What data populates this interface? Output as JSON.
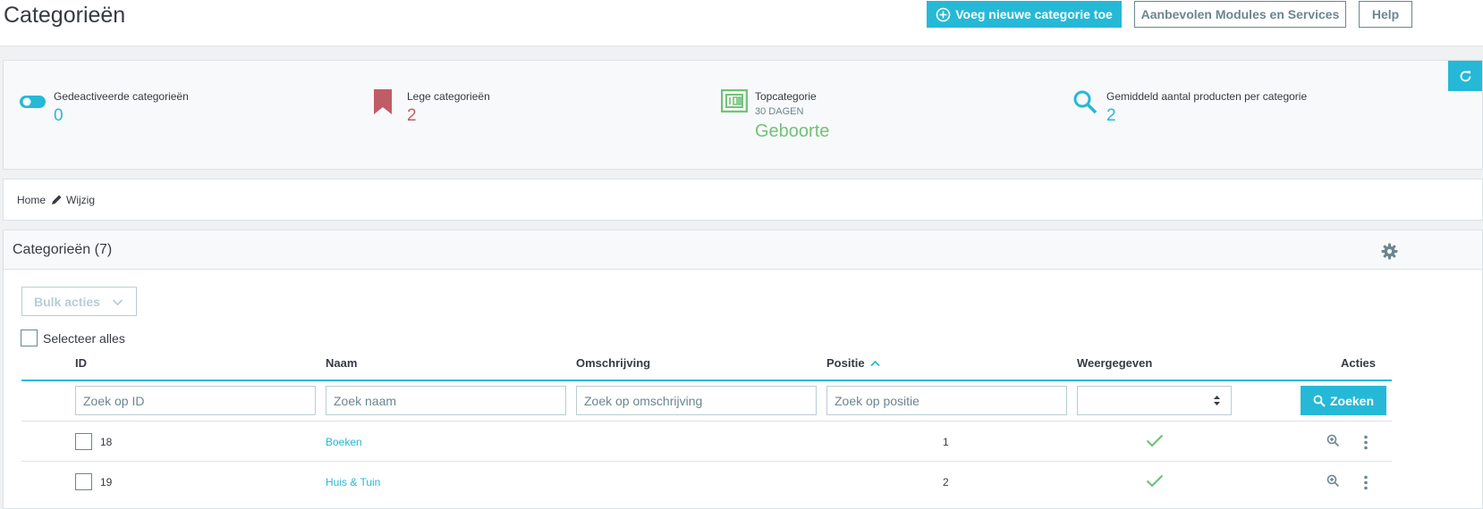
{
  "header": {
    "title": "Categorieën",
    "add_button": "Voeg nieuwe categorie toe",
    "modules_button": "Aanbevolen Modules en Services",
    "help_button": "Help"
  },
  "kpis": [
    {
      "label": "Gedeactiveerde categorieën",
      "value": "0",
      "color": "#25b9d7",
      "icon": "toggle-icon"
    },
    {
      "label": "Lege categorieën",
      "value": "2",
      "color": "#c05c67",
      "icon": "bookmark-icon"
    },
    {
      "label": "Topcategorie",
      "sub": "30 DAGEN",
      "value": "Geboorte",
      "color": "#72c279",
      "icon": "money-icon"
    },
    {
      "label": "Gemiddeld aantal producten per categorie",
      "value": "2",
      "color": "#25b9d7",
      "icon": "search-icon"
    }
  ],
  "breadcrumb": {
    "home": "Home",
    "current": "Wijzig"
  },
  "list": {
    "title": "Categorieën (7)",
    "bulk_label": "Bulk acties",
    "select_all": "Selecteer alles",
    "columns": {
      "id": "ID",
      "name": "Naam",
      "description": "Omschrijving",
      "position": "Positie",
      "displayed": "Weergegeven",
      "actions": "Acties"
    },
    "filters": {
      "id_placeholder": "Zoek op ID",
      "name_placeholder": "Zoek naam",
      "description_placeholder": "Zoek op omschrijving",
      "position_placeholder": "Zoek op positie",
      "search_button": "Zoeken"
    },
    "rows": [
      {
        "id": "18",
        "name": "Boeken",
        "position": "1",
        "displayed": true
      },
      {
        "id": "19",
        "name": "Huis & Tuin",
        "position": "2",
        "displayed": true
      }
    ]
  },
  "colors": {
    "accent": "#25b9d7",
    "success": "#72c279",
    "danger": "#c05c67"
  }
}
